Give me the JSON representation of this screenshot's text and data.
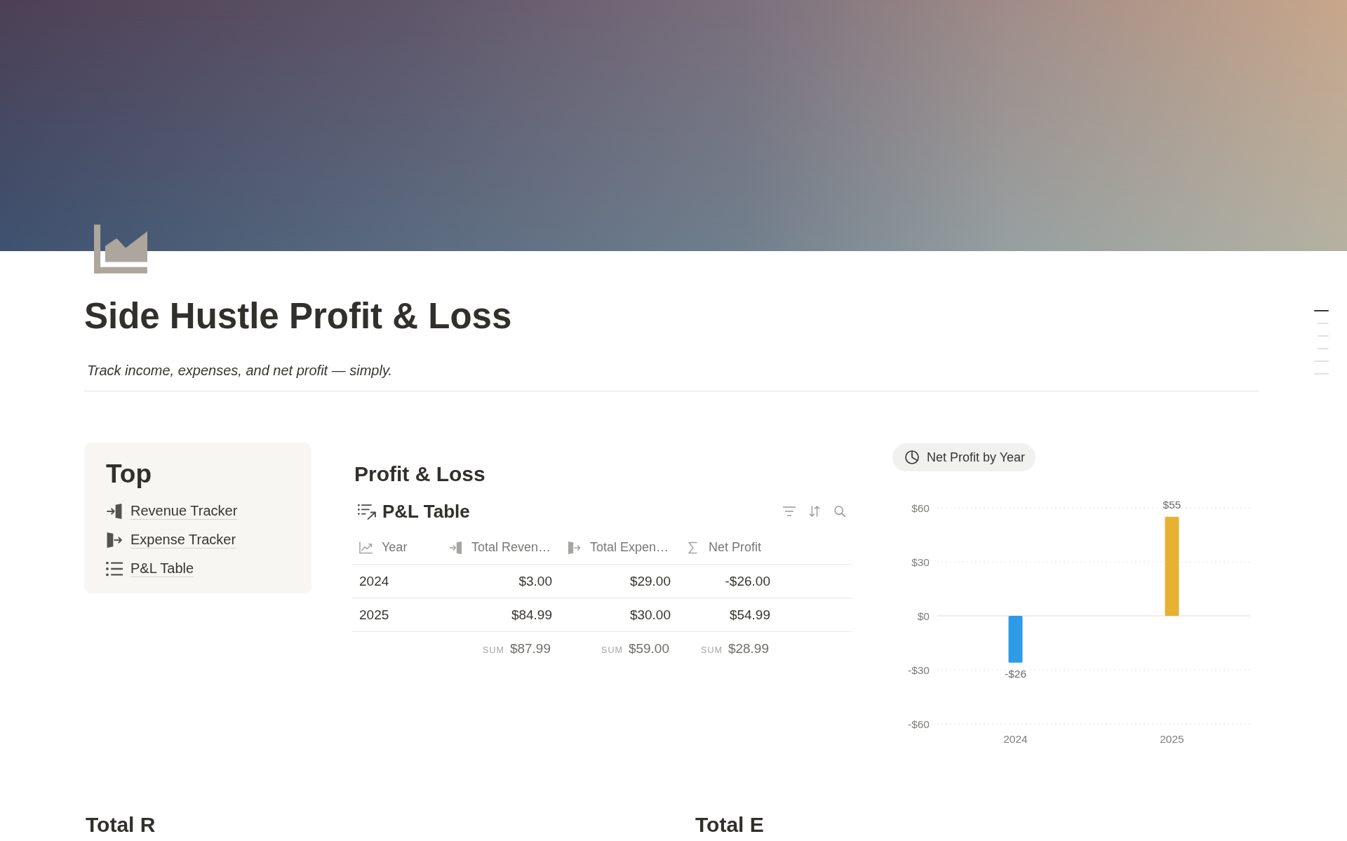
{
  "page": {
    "title": "Side Hustle Profit & Loss",
    "description": "Track income, expenses, and net profit — simply."
  },
  "outline": [
    {
      "selected": true,
      "children": [
        {
          "selected": false
        },
        {
          "selected": false
        },
        {
          "selected": false
        }
      ]
    },
    {
      "selected": false
    },
    {
      "selected": false
    }
  ],
  "top_callout": {
    "heading": "Top",
    "links": [
      "Revenue Tracker",
      "Expense Tracker",
      "P&L Table"
    ]
  },
  "profit_and_loss": {
    "heading": "Profit & Loss",
    "database": {
      "title": "P&L Table",
      "columns": [
        {
          "label": "Year",
          "kind": "title"
        },
        {
          "label": "Total Reven…",
          "kind": "number"
        },
        {
          "label": "Total Expen…",
          "kind": "number"
        },
        {
          "label": "Net Profit",
          "kind": "formula"
        }
      ],
      "rows": [
        [
          "2024",
          "$3.00",
          "$29.00",
          "-$26.00"
        ],
        [
          "2025",
          "$84.99",
          "$30.00",
          "$54.99"
        ]
      ],
      "summary": [
        {
          "label": "SUM",
          "value": "$87.99"
        },
        {
          "label": "SUM",
          "value": "$59.00"
        },
        {
          "label": "SUM",
          "value": "$28.99"
        }
      ]
    }
  },
  "net_profit_chart": {
    "view_tab": {
      "label": "Net Profit by Year",
      "selected": true
    },
    "chart_data": {
      "type": "bar",
      "categories": [
        "2024",
        "2025"
      ],
      "series": [
        {
          "color": "#2f9be6",
          "values": [
            -26,
            null
          ]
        },
        {
          "color": "#e6b233",
          "values": [
            null,
            55
          ]
        }
      ],
      "ylim": [
        -60,
        60
      ],
      "yticks": [
        {
          "value": 60,
          "label": "$60"
        },
        {
          "value": 30,
          "label": "$30"
        },
        {
          "value": 0,
          "label": "$0"
        },
        {
          "value": -30,
          "label": "-$30"
        },
        {
          "value": -60,
          "label": "-$60"
        }
      ],
      "value_labels": [
        "-$26",
        "$55"
      ]
    }
  },
  "bottom_headings": [
    "Total R",
    "Total E"
  ]
}
